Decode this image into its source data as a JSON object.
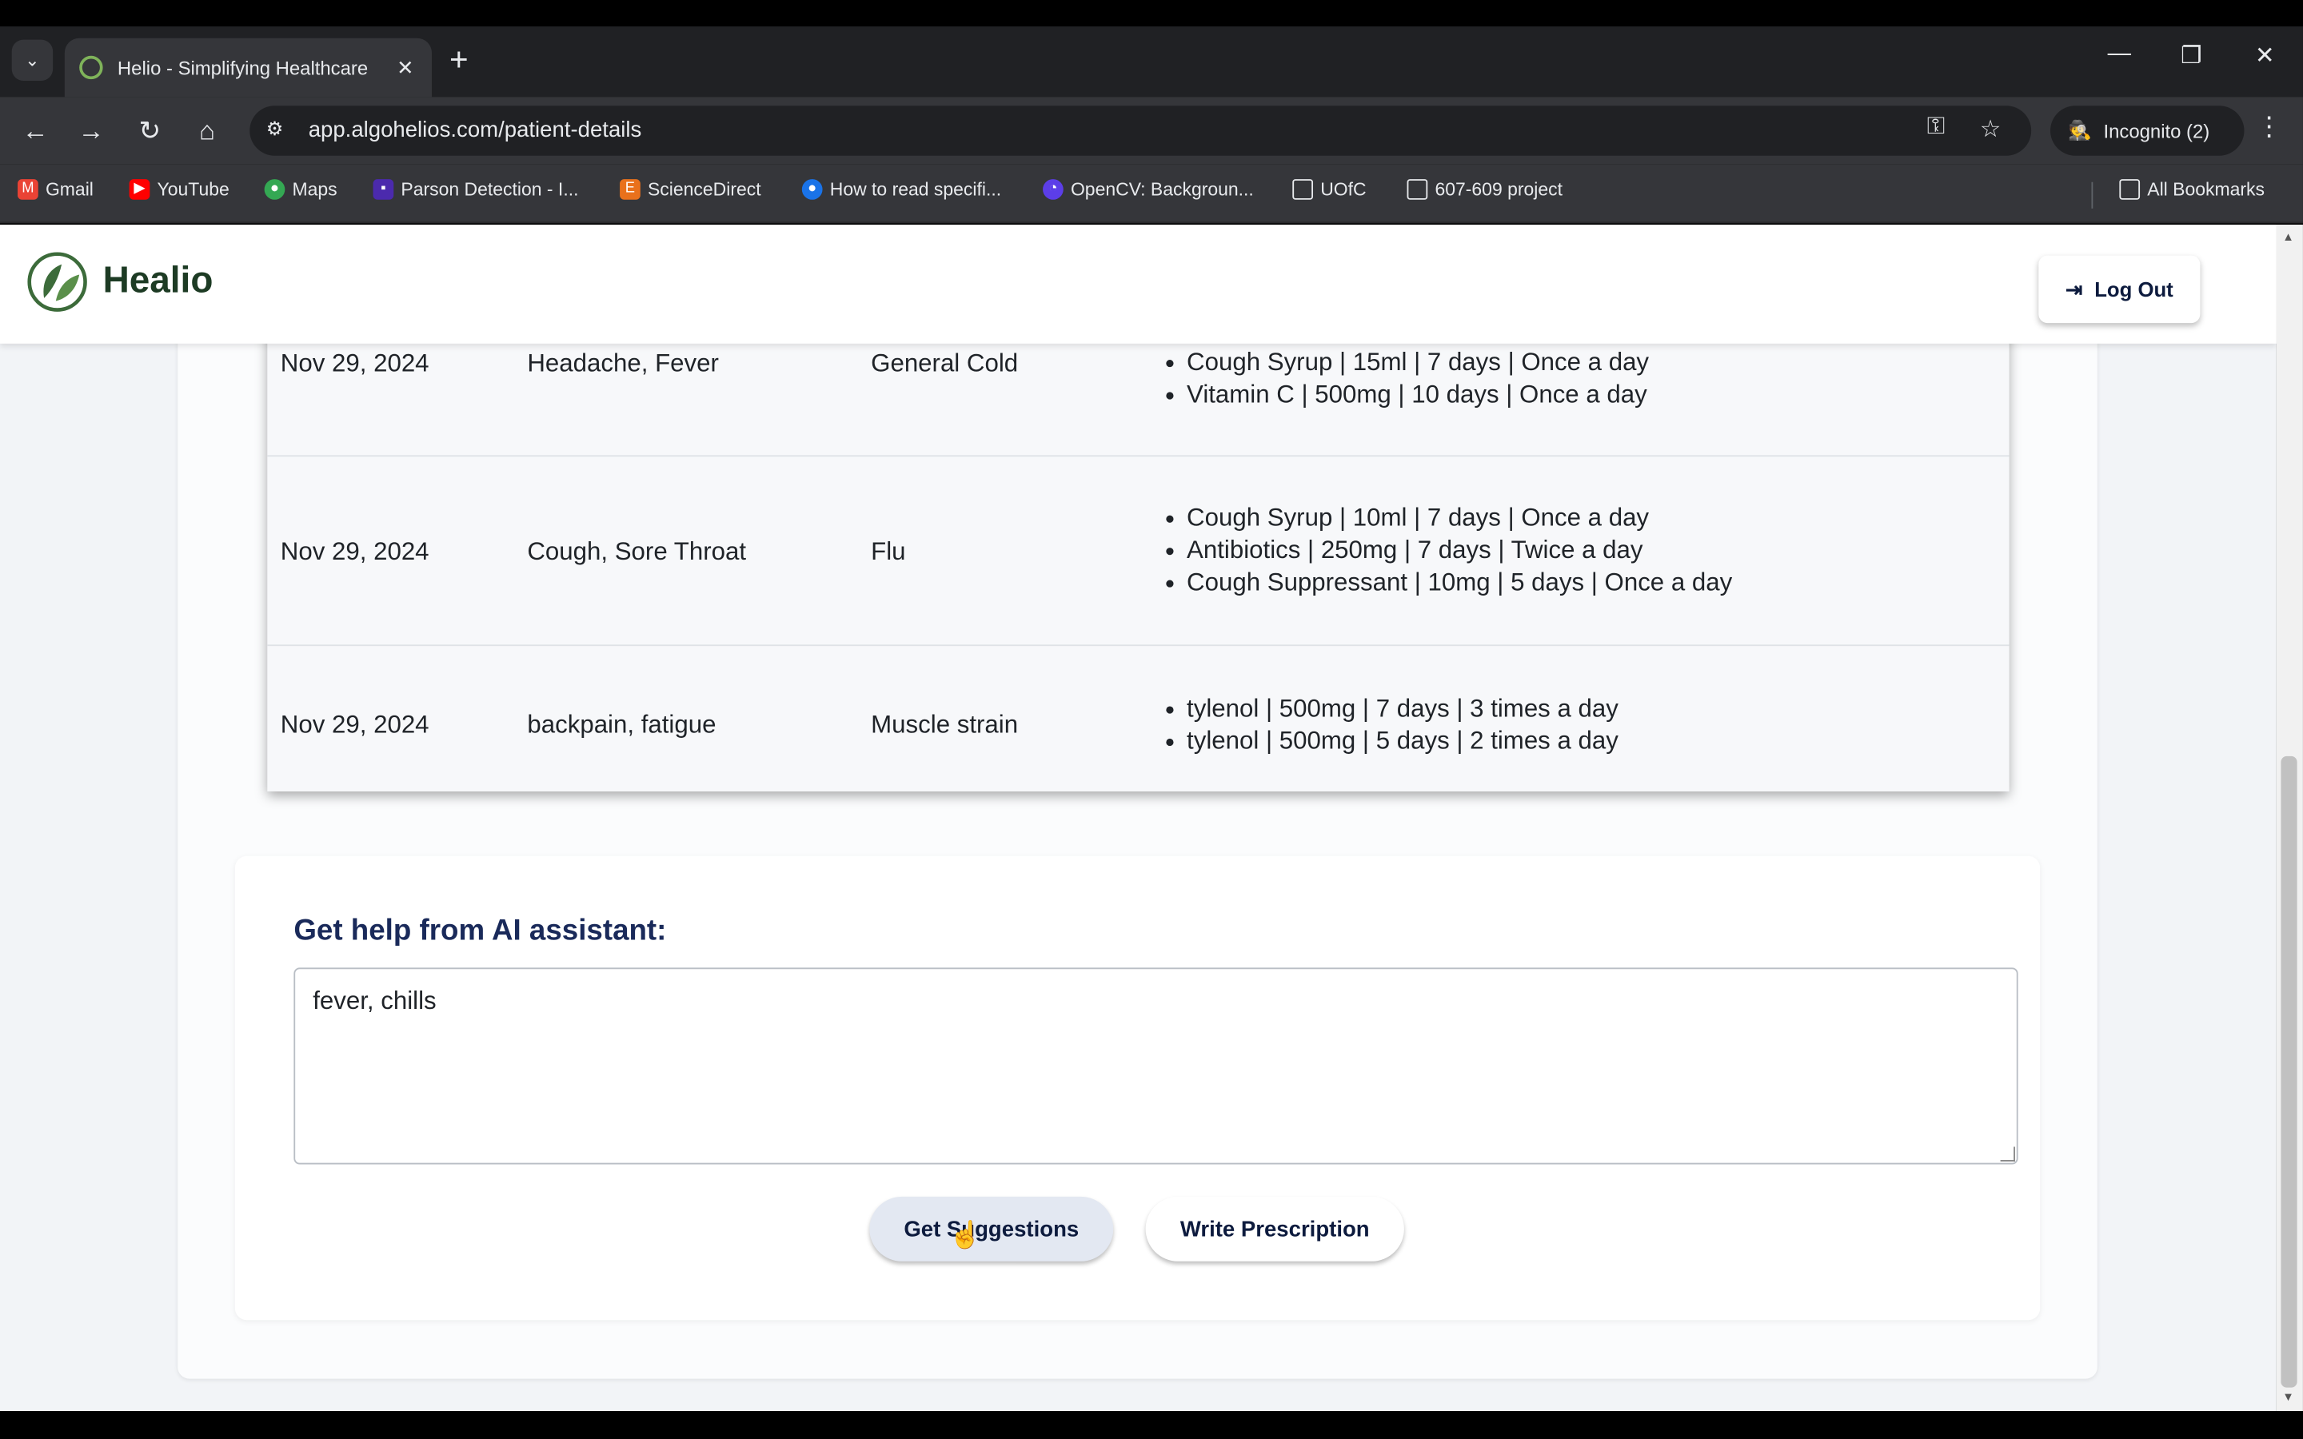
{
  "browser": {
    "tab_title": "Helio - Simplifying Healthcare",
    "url": "app.algohelios.com/patient-details",
    "incognito_label": "Incognito (2)",
    "bookmarks": [
      {
        "label": "Gmail",
        "icon": "gmail-icon",
        "color": "#ea4335"
      },
      {
        "label": "YouTube",
        "icon": "youtube-icon",
        "color": "#ff0000"
      },
      {
        "label": "Maps",
        "icon": "maps-pin-icon",
        "color": "#34a853"
      },
      {
        "label": "Parson Detection - I...",
        "icon": "bookmark-favicon",
        "color": "#4b2aad"
      },
      {
        "label": "ScienceDirect",
        "icon": "sciencedirect-icon",
        "color": "#e9711c"
      },
      {
        "label": "How to read specifi...",
        "icon": "bookmark-favicon",
        "color": "#1a73e8"
      },
      {
        "label": "OpenCV: Backgroun...",
        "icon": "opencv-icon",
        "color": "#5c3ee8"
      },
      {
        "label": "UOfC",
        "icon": "folder-icon",
        "color": "#e8eaed"
      },
      {
        "label": "607-609 project",
        "icon": "folder-icon",
        "color": "#e8eaed"
      }
    ],
    "all_bookmarks_label": "All Bookmarks"
  },
  "header": {
    "brand": "Healio",
    "logout_label": "Log Out"
  },
  "history": {
    "rows": [
      {
        "date": "Nov 29, 2024",
        "symptoms": "Headache, Fever",
        "diagnosis": "General Cold",
        "medications": [
          "Cough Syrup | 15ml | 7 days | Once a day",
          "Vitamin C | 500mg | 10 days | Once a day"
        ]
      },
      {
        "date": "Nov 29, 2024",
        "symptoms": "Cough, Sore Throat",
        "diagnosis": "Flu",
        "medications": [
          "Cough Syrup | 10ml | 7 days | Once a day",
          "Antibiotics | 250mg | 7 days | Twice a day",
          "Cough Suppressant | 10mg | 5 days | Once a day"
        ]
      },
      {
        "date": "Nov 29, 2024",
        "symptoms": "backpain, fatigue",
        "diagnosis": "Muscle strain",
        "medications": [
          "tylenol | 500mg | 7 days | 3 times a day",
          "tylenol | 500mg | 5 days | 2 times a day"
        ]
      }
    ]
  },
  "assistant": {
    "title": "Get help from AI assistant:",
    "input_value": "fever, chills",
    "suggest_label": "Get Suggestions",
    "write_label": "Write Prescription"
  }
}
